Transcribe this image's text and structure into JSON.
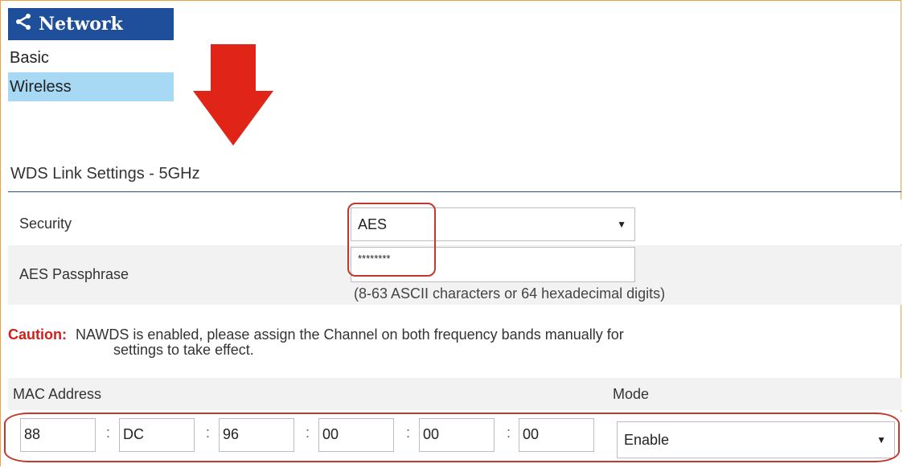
{
  "nav": {
    "title": "Network",
    "icon": "share-icon",
    "items": [
      {
        "label": "Basic",
        "selected": false
      },
      {
        "label": "Wireless",
        "selected": true
      }
    ]
  },
  "section": {
    "title": "WDS Link Settings - 5GHz"
  },
  "security": {
    "label": "Security",
    "value": "AES"
  },
  "passphrase": {
    "label": "AES Passphrase",
    "value": "********",
    "hint": "(8-63 ASCII characters or 64 hexadecimal digits)"
  },
  "caution": {
    "label": "Caution:",
    "line1": "NAWDS is enabled, please assign the Channel on both frequency bands manually for",
    "line2": "settings to take effect."
  },
  "mac_table": {
    "col_mac": "MAC Address",
    "col_mode": "Mode",
    "octets": [
      "88",
      "DC",
      "96",
      "00",
      "00",
      "00"
    ],
    "separator": ":",
    "mode": "Enable"
  },
  "colors": {
    "nav_header": "#1f4e9a",
    "nav_selected": "#a7d9f5",
    "highlight": "#c0392b",
    "caution": "#d0201a"
  }
}
